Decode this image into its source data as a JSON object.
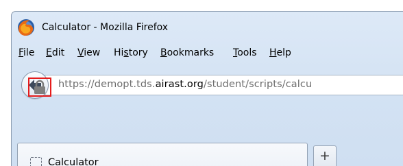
{
  "window": {
    "title": "Calculator - Mozilla Firefox"
  },
  "menubar": {
    "items": [
      {
        "accel": "F",
        "rest": "ile"
      },
      {
        "accel": "E",
        "rest": "dit"
      },
      {
        "accel": "V",
        "rest": "iew"
      },
      {
        "pre": "Hi",
        "accel": "s",
        "rest": "tory"
      },
      {
        "accel": "B",
        "rest": "ookmarks"
      },
      {
        "accel": "T",
        "rest": "ools"
      },
      {
        "accel": "H",
        "rest": "elp"
      }
    ]
  },
  "navbar": {
    "url_prefix": "https://demopt.tds.",
    "url_domain": "airast.org",
    "url_suffix": "/student/scripts/calcu"
  },
  "tabs": {
    "active_label": "Calculator",
    "new_tab_label": "+"
  },
  "colors": {
    "highlight_box": "#e51c1c"
  }
}
